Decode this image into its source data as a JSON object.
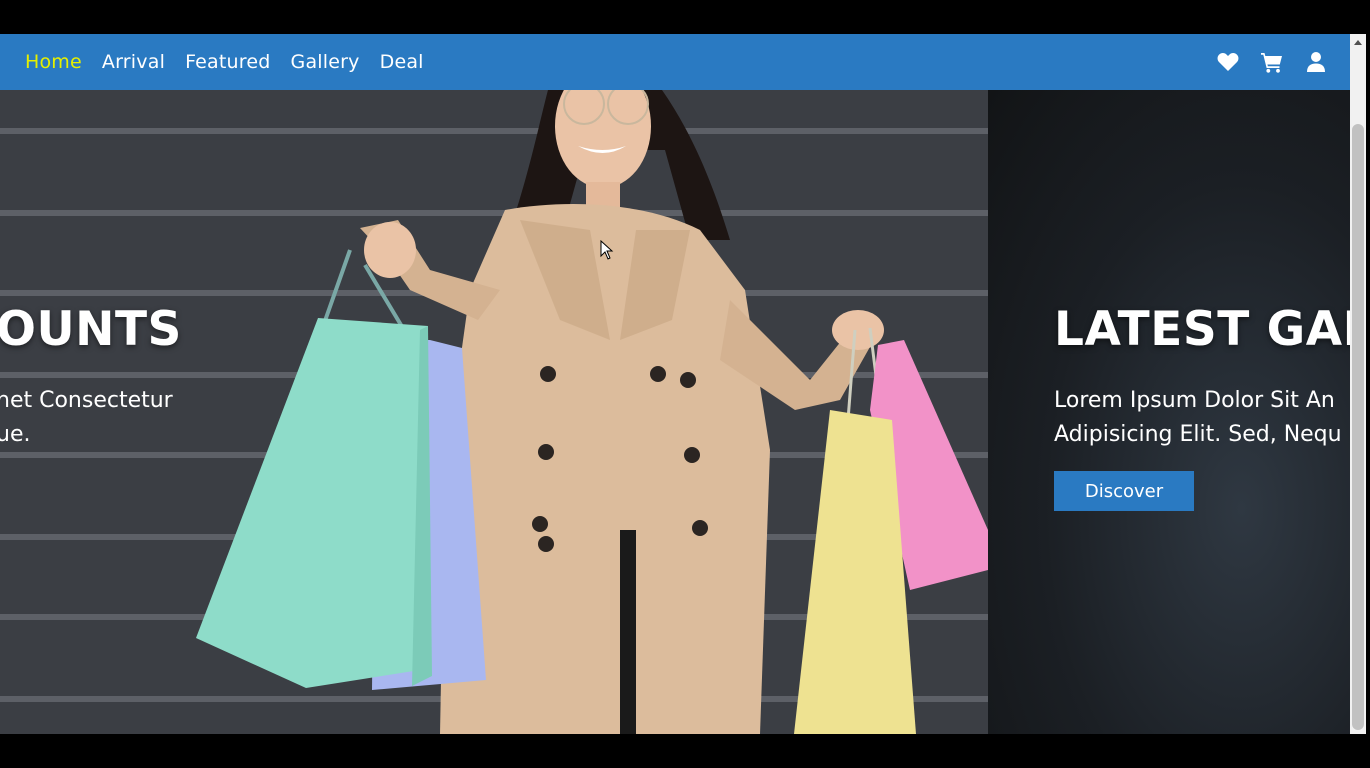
{
  "nav": {
    "links": [
      "Home",
      "Arrival",
      "Featured",
      "Gallery",
      "Deal"
    ],
    "active": "Home",
    "icons": [
      "heart-icon",
      "cart-icon",
      "user-icon"
    ]
  },
  "slides": {
    "left": {
      "headline": "OUNTS",
      "line1": "net Consectetur",
      "line2": "ue."
    },
    "right": {
      "headline": "LATEST GADG",
      "line1": "Lorem Ipsum Dolor Sit An",
      "line2": "Adipisicing Elit. Sed, Nequ",
      "button": "Discover"
    }
  },
  "colors": {
    "navbar": "#2a7ac2",
    "active_link": "#e6f000",
    "button": "#2a7ac2"
  }
}
